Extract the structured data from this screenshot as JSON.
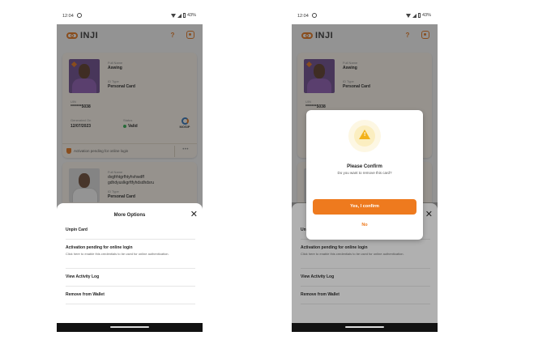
{
  "status": {
    "time": "12:04",
    "battery": "43%"
  },
  "brand": {
    "logo_text": "INJI",
    "accent": "#e0741d"
  },
  "card1": {
    "full_name_label": "Full Name",
    "full_name": "Aswing",
    "id_type_label": "ID Type",
    "id_type": "Personal Card",
    "uin_label": "UIN",
    "uin": "*******5038",
    "generated_on_label": "Generated On",
    "generated_on": "12/07/2023",
    "status_label": "Status",
    "status": "Valid",
    "issuer": "MOSIP",
    "pending_text": "Activation pending for online login"
  },
  "card2": {
    "full_name_label": "Full Name",
    "full_name": "dvgfrhtgrfhtyhvhwdff",
    "full_name_line2": "gdhdyuslkgrftfyhdsdhdsru",
    "id_type_label": "ID Type",
    "id_type": "Personal Card"
  },
  "sheet": {
    "title": "More Options",
    "options": [
      {
        "label": "Unpin Card"
      },
      {
        "label": "Activation pending for online login",
        "desc": "Click here to enable this credentials to be used for online authentication."
      },
      {
        "label": "View Activity Log"
      },
      {
        "label": "Remove from Wallet"
      }
    ],
    "options_right_partial": [
      "Un",
      "Activation pending for online login",
      "View Activity Log",
      "Remove from Wallet"
    ],
    "options_right_desc": "Click here to enable this credentials to be used for online authentication."
  },
  "dialog": {
    "title": "Please Confirm",
    "message": "Do you want to remove this card?",
    "confirm_label": "Yes, I confirm",
    "cancel_label": "No"
  },
  "colors": {
    "confirm": "#ee7a1e",
    "valid": "#2fa84f",
    "warning": "#f2b21b"
  }
}
